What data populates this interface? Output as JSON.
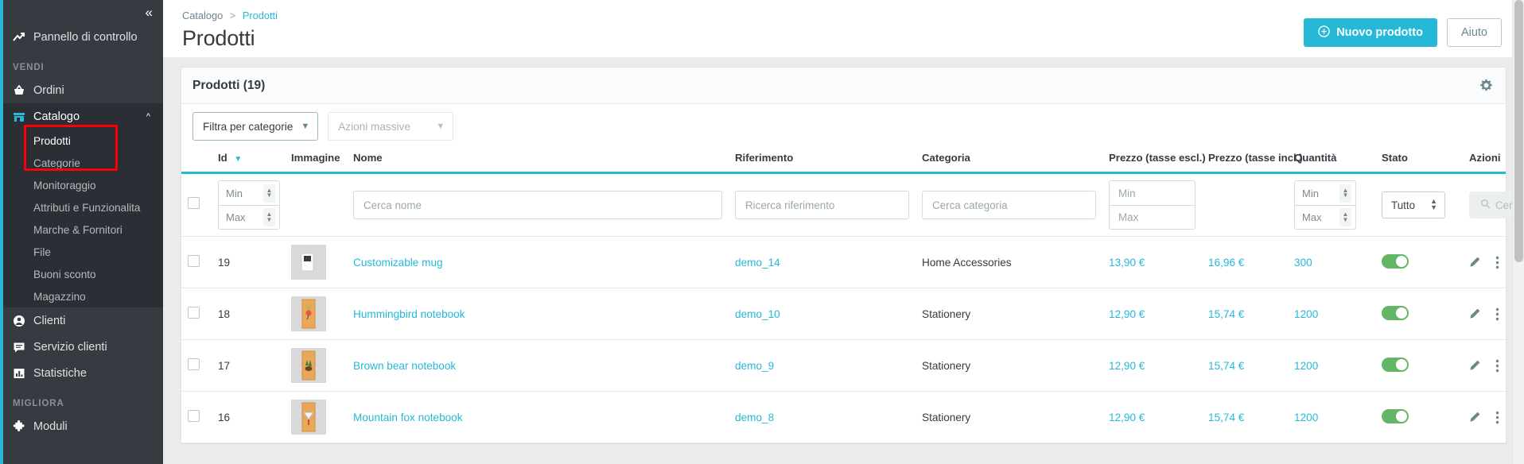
{
  "sidebar": {
    "collapse_icon": "double-chevron-left",
    "dashboard": {
      "label": "Pannello di controllo",
      "icon": "trend-line-icon"
    },
    "sections": [
      {
        "title": "VENDI",
        "items": [
          {
            "label": "Ordini",
            "icon": "basket-icon"
          },
          {
            "label": "Catalogo",
            "icon": "store-icon",
            "expanded": true,
            "children": [
              {
                "label": "Prodotti",
                "current": true
              },
              {
                "label": "Categorie"
              },
              {
                "label": "Monitoraggio"
              },
              {
                "label": "Attributi e Funzionalita"
              },
              {
                "label": "Marche & Fornitori"
              },
              {
                "label": "File"
              },
              {
                "label": "Buoni sconto"
              },
              {
                "label": "Magazzino"
              }
            ]
          },
          {
            "label": "Clienti",
            "icon": "user-icon"
          },
          {
            "label": "Servizio clienti",
            "icon": "chat-icon"
          },
          {
            "label": "Statistiche",
            "icon": "bar-chart-icon"
          }
        ]
      },
      {
        "title": "MIGLIORA",
        "items": [
          {
            "label": "Moduli",
            "icon": "puzzle-icon"
          }
        ]
      }
    ]
  },
  "header": {
    "breadcrumb": {
      "parent": "Catalogo",
      "separator": ">",
      "current": "Prodotti"
    },
    "title": "Prodotti",
    "new_product_button": "Nuovo prodotto",
    "help_button": "Aiuto"
  },
  "panel": {
    "title": "Prodotti (19)",
    "settings_icon": "gear-icon",
    "filter_category": "Filtra per categorie",
    "bulk_actions": "Azioni massive"
  },
  "table": {
    "columns": [
      "Id",
      "Immagine",
      "Nome",
      "Riferimento",
      "Categoria",
      "Prezzo (tasse escl.)",
      "Prezzo (tasse incl.)",
      "Quantità",
      "Stato",
      "Azioni"
    ],
    "sort_column": "Id",
    "sort_direction": "desc",
    "filters": {
      "id_min": "Min",
      "id_max": "Max",
      "name": "Cerca nome",
      "reference": "Ricerca riferimento",
      "category": "Cerca categoria",
      "price_excl_min": "Min",
      "price_excl_max": "Max",
      "quantity_min": "Min",
      "quantity_max": "Max",
      "status": "Tutto",
      "search_button": "Cerca"
    },
    "rows": [
      {
        "id": "19",
        "name": "Customizable mug",
        "reference": "demo_14",
        "category": "Home Accessories",
        "price_excl": "13,90 €",
        "price_incl": "16,96 €",
        "quantity": "300",
        "enabled": true,
        "thumb_kind": "mug"
      },
      {
        "id": "18",
        "name": "Hummingbird notebook",
        "reference": "demo_10",
        "category": "Stationery",
        "price_excl": "12,90 €",
        "price_incl": "15,74 €",
        "quantity": "1200",
        "enabled": true,
        "thumb_kind": "notebook-hummingbird"
      },
      {
        "id": "17",
        "name": "Brown bear notebook",
        "reference": "demo_9",
        "category": "Stationery",
        "price_excl": "12,90 €",
        "price_incl": "15,74 €",
        "quantity": "1200",
        "enabled": true,
        "thumb_kind": "notebook-bear"
      },
      {
        "id": "16",
        "name": "Mountain fox notebook",
        "reference": "demo_8",
        "category": "Stationery",
        "price_excl": "12,90 €",
        "price_incl": "15,74 €",
        "quantity": "1200",
        "enabled": true,
        "thumb_kind": "notebook-fox"
      }
    ]
  },
  "colors": {
    "accent": "#25b9d7",
    "sidebar_bg": "#363a41",
    "sidebar_open_bg": "#2b2e34",
    "status_on": "#64b667",
    "annotation": "#fb0007",
    "page_bg": "#eaebec"
  }
}
